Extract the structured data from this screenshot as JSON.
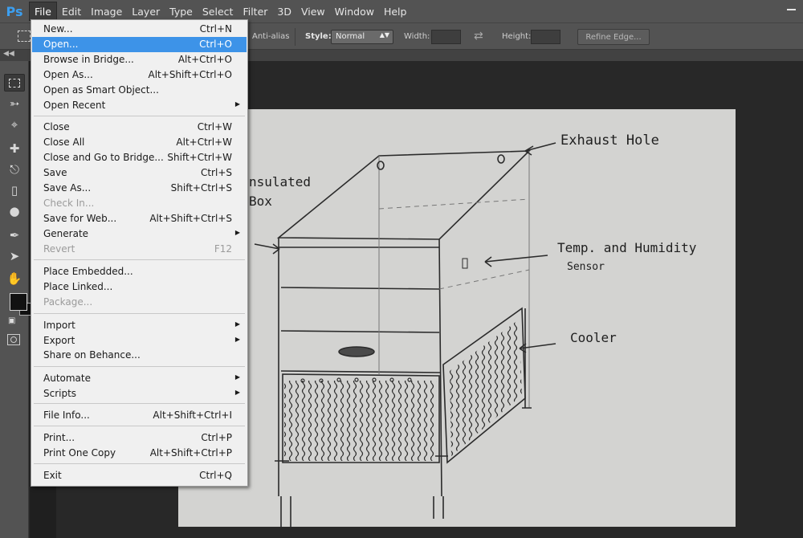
{
  "app": {
    "logo": "Ps",
    "menus": [
      "File",
      "Edit",
      "Image",
      "Layer",
      "Type",
      "Select",
      "Filter",
      "3D",
      "View",
      "Window",
      "Help"
    ],
    "active_menu": "File"
  },
  "options_bar": {
    "anti_alias_label": "Anti-alias",
    "style_label": "Style:",
    "style_value": "Normal",
    "width_label": "Width:",
    "height_label": "Height:",
    "refine_edge_label": "Refine Edge...",
    "swap_icon": "swap-arrows-icon"
  },
  "file_menu": {
    "items": [
      {
        "label": "New...",
        "shortcut": "Ctrl+N"
      },
      {
        "label": "Open...",
        "shortcut": "Ctrl+O",
        "highlighted": true
      },
      {
        "label": "Browse in Bridge...",
        "shortcut": "Alt+Ctrl+O"
      },
      {
        "label": "Open As...",
        "shortcut": "Alt+Shift+Ctrl+O"
      },
      {
        "label": "Open as Smart Object...",
        "shortcut": ""
      },
      {
        "label": "Open Recent",
        "shortcut": "",
        "submenu": true
      },
      {
        "label": "Close",
        "shortcut": "Ctrl+W"
      },
      {
        "label": "Close All",
        "shortcut": "Alt+Ctrl+W"
      },
      {
        "label": "Close and Go to Bridge...",
        "shortcut": "Shift+Ctrl+W"
      },
      {
        "label": "Save",
        "shortcut": "Ctrl+S"
      },
      {
        "label": "Save As...",
        "shortcut": "Shift+Ctrl+S"
      },
      {
        "label": "Check In...",
        "shortcut": "",
        "disabled": true
      },
      {
        "label": "Save for Web...",
        "shortcut": "Alt+Shift+Ctrl+S"
      },
      {
        "label": "Generate",
        "shortcut": "",
        "submenu": true
      },
      {
        "label": "Revert",
        "shortcut": "F12",
        "disabled": true
      },
      {
        "label": "Place Embedded...",
        "shortcut": ""
      },
      {
        "label": "Place Linked...",
        "shortcut": ""
      },
      {
        "label": "Package...",
        "shortcut": "",
        "disabled": true
      },
      {
        "label": "Import",
        "shortcut": "",
        "submenu": true
      },
      {
        "label": "Export",
        "shortcut": "",
        "submenu": true
      },
      {
        "label": "Share on Behance...",
        "shortcut": ""
      },
      {
        "label": "Automate",
        "shortcut": "",
        "submenu": true
      },
      {
        "label": "Scripts",
        "shortcut": "",
        "submenu": true
      },
      {
        "label": "File Info...",
        "shortcut": "Alt+Shift+Ctrl+I"
      },
      {
        "label": "Print...",
        "shortcut": "Ctrl+P"
      },
      {
        "label": "Print One Copy",
        "shortcut": "Alt+Shift+Ctrl+P"
      },
      {
        "label": "Exit",
        "shortcut": "Ctrl+Q"
      }
    ]
  },
  "sketch_annotations": {
    "exhaust": "Exhaust Hole",
    "insulated_line1": "nsulated",
    "insulated_line2": "Box",
    "temp_line1": "Temp. and Humidity",
    "temp_line2": "Sensor",
    "cooler": "Cooler"
  },
  "toolbar": {
    "tools": [
      "marquee-icon",
      "lasso-icon",
      "crop-icon",
      "healing-brush-icon",
      "clone-stamp-icon",
      "eraser-icon",
      "blur-drop-icon",
      "pen-icon",
      "path-select-icon",
      "hand-icon"
    ],
    "foreground_color": "#111111",
    "background_color": "#111111"
  }
}
